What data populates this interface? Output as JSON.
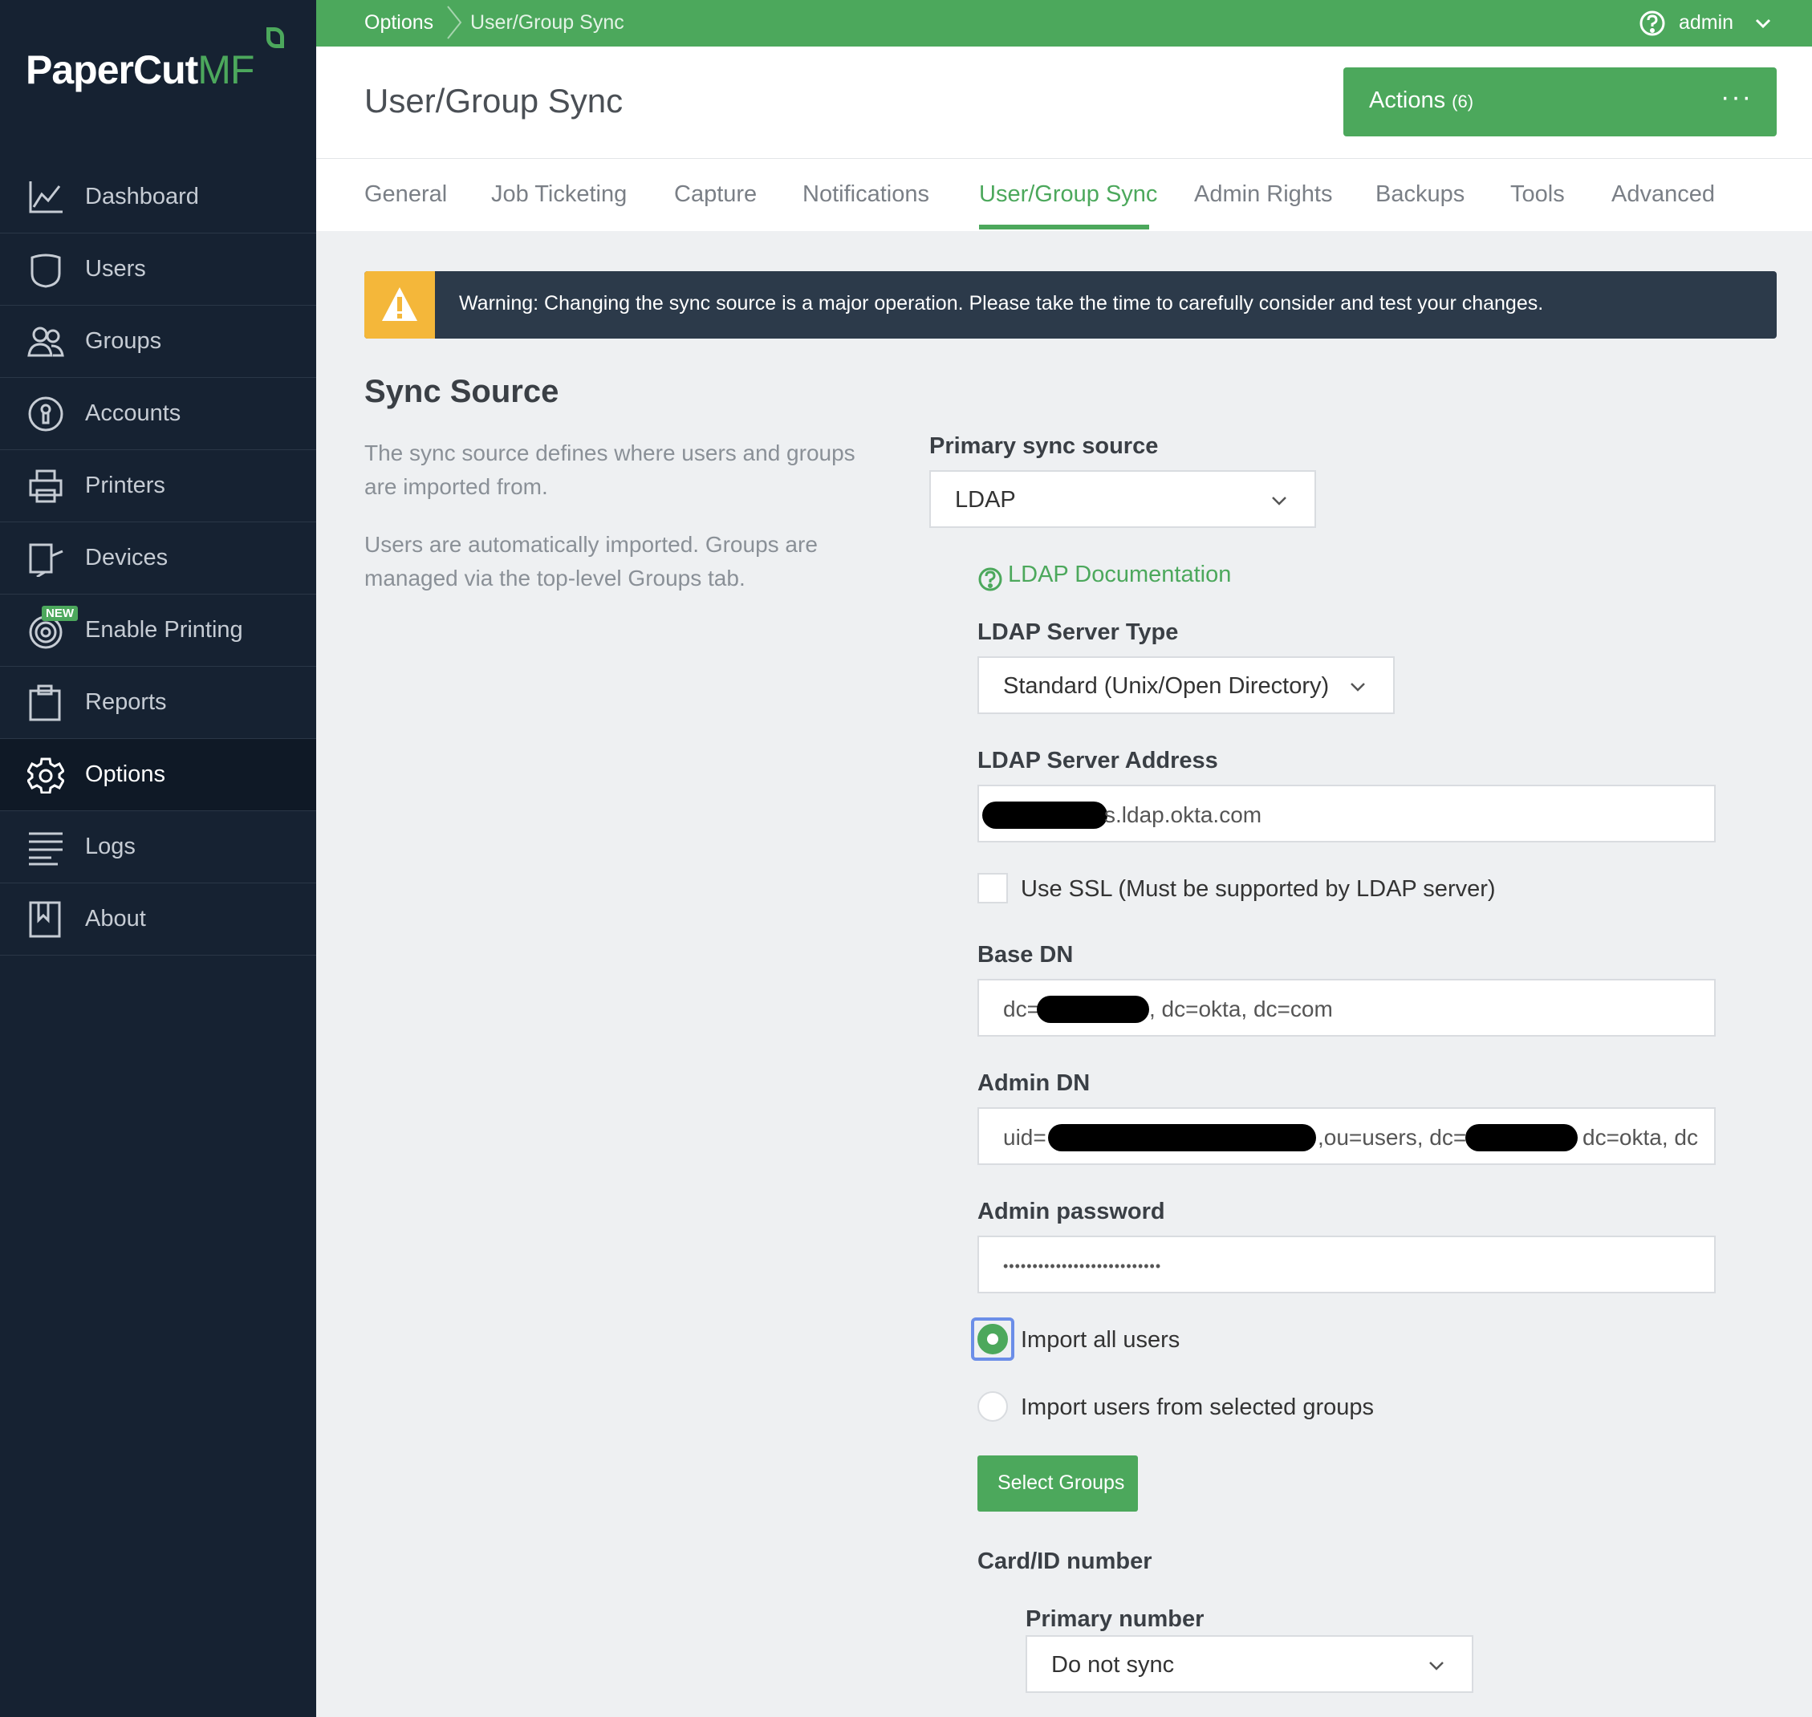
{
  "app": {
    "logo_main": "PaperCut",
    "logo_suffix": "MF"
  },
  "sidebar": {
    "items": [
      {
        "label": "Dashboard",
        "icon": "chart-icon",
        "active": false
      },
      {
        "label": "Users",
        "icon": "user-icon",
        "active": false
      },
      {
        "label": "Groups",
        "icon": "groups-icon",
        "active": false
      },
      {
        "label": "Accounts",
        "icon": "accounts-icon",
        "active": false
      },
      {
        "label": "Printers",
        "icon": "printer-icon",
        "active": false
      },
      {
        "label": "Devices",
        "icon": "devices-icon",
        "active": false
      },
      {
        "label": "Enable Printing",
        "icon": "target-icon",
        "active": false,
        "badge": "NEW"
      },
      {
        "label": "Reports",
        "icon": "clipboard-icon",
        "active": false
      },
      {
        "label": "Options",
        "icon": "gear-icon",
        "active": true
      },
      {
        "label": "Logs",
        "icon": "lines-icon",
        "active": false
      },
      {
        "label": "About",
        "icon": "book-icon",
        "active": false
      }
    ]
  },
  "topbar": {
    "breadcrumb": [
      "Options",
      "User/Group Sync"
    ],
    "user": "admin"
  },
  "header": {
    "title": "User/Group Sync",
    "actions_label": "Actions",
    "actions_count": "(6)",
    "actions_more": "···"
  },
  "tabs": [
    "General",
    "Job Ticketing",
    "Capture",
    "Notifications",
    "User/Group Sync",
    "Admin Rights",
    "Backups",
    "Tools",
    "Advanced"
  ],
  "active_tab": "User/Group Sync",
  "warning": {
    "text": "Warning: Changing the sync source is a major operation. Please take the time to carefully consider and test your changes."
  },
  "sync_source": {
    "title": "Sync Source",
    "desc1": "The sync source defines where users and groups are imported from.",
    "desc2": "Users are automatically imported. Groups are managed via the top-level Groups tab.",
    "primary_label": "Primary sync source",
    "primary_value": "LDAP",
    "doc_link": "LDAP Documentation",
    "server_type_label": "LDAP Server Type",
    "server_type_value": "Standard (Unix/Open Directory)",
    "server_address_label": "LDAP Server Address",
    "server_address_value": "s.ldap.okta.com",
    "ssl_label": "Use SSL (Must be supported by LDAP server)",
    "ssl_checked": false,
    "base_dn_label": "Base DN",
    "base_dn_prefix": "dc=",
    "base_dn_suffix": ", dc=okta, dc=com",
    "admin_dn_label": "Admin DN",
    "admin_dn_prefix": "uid=",
    "admin_dn_middle": ",ou=users, dc=",
    "admin_dn_suffix": "dc=okta, dc",
    "admin_password_label": "Admin password",
    "admin_password_value": "•••••••••••••••••••••••••••",
    "radio_all_label": "Import all users",
    "radio_groups_label": "Import users from selected groups",
    "selected_option": "Import all users",
    "select_groups_label": "Select Groups",
    "card_label": "Card/ID number",
    "primary_number_label": "Primary number",
    "primary_number_value": "Do not sync"
  },
  "colors": {
    "accent": "#4ca85c",
    "sidebar": "#162232",
    "warning": "#f4b73a"
  }
}
